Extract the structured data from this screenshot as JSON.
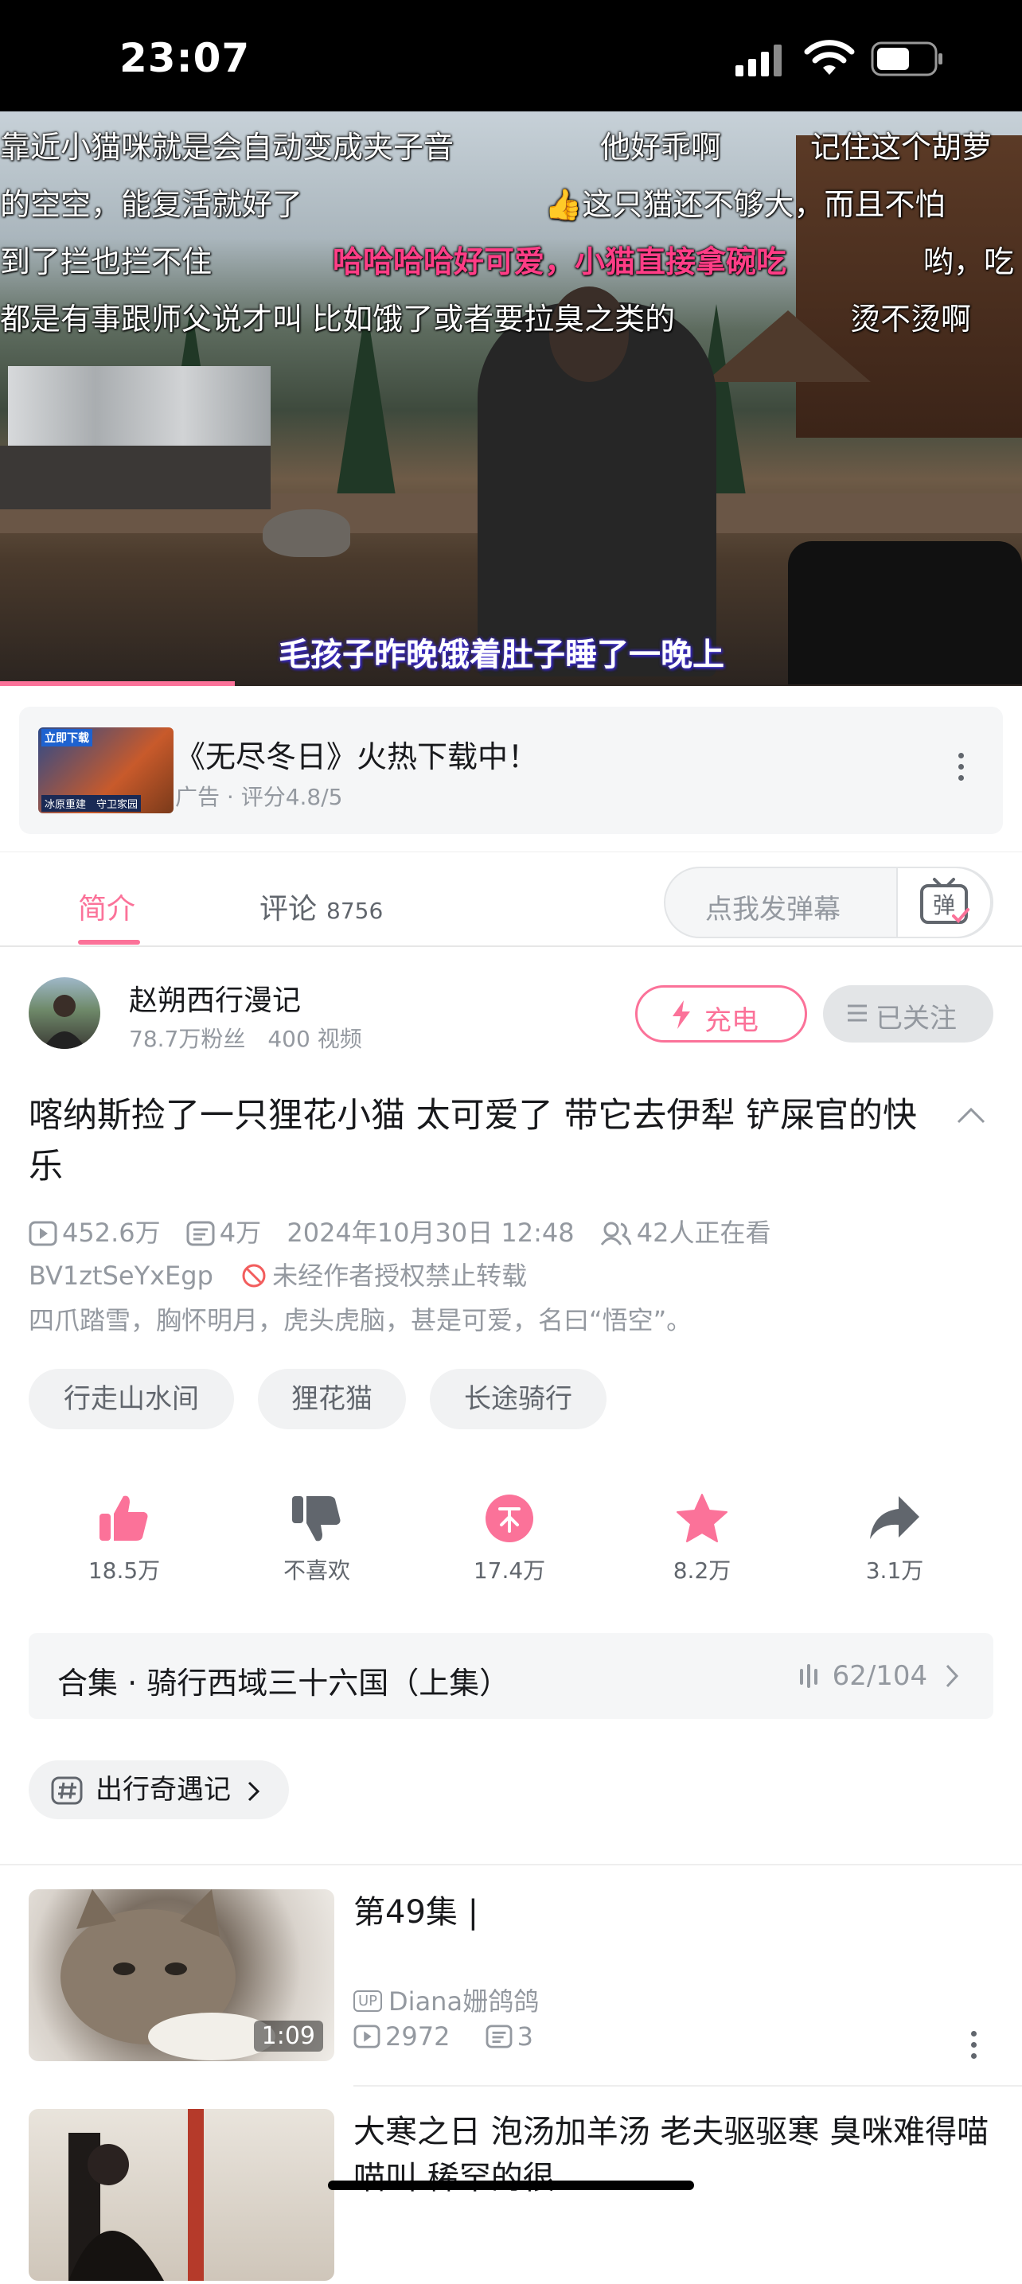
{
  "status": {
    "time": "23:07"
  },
  "video": {
    "danmaku": [
      "靠近小猫咪就是会自动变成夹子音",
      "他好乖啊",
      "记住这个胡萝",
      "的空空，能复活就好了",
      "这只猫还不够大，而且不怕",
      "到了拦也拦不住",
      "哈哈哈哈好可爱，小猫直接拿碗吃",
      "哟，吃",
      "都是有事跟师父说才叫 比如饿了或者要拉臭之类的",
      "烫不烫啊"
    ],
    "subtitle": "毛孩子昨晚饿着肚子睡了一晚上",
    "progress": 0.23
  },
  "ad": {
    "thumb_top": "立即下载",
    "thumb_bottom": "冰原重建　守卫家园",
    "title": "《无尽冬日》火热下载中！",
    "subtitle": "广告 · 评分4.8/5"
  },
  "tabs": {
    "intro": "简介",
    "comments": "评论",
    "comments_count": "8756",
    "danmu_placeholder": "点我发弹幕",
    "danmu_button": "弹"
  },
  "uploader": {
    "name": "赵朔西行漫记",
    "meta": "78.7万粉丝　400 视频",
    "charge": "充电",
    "follow": "已关注"
  },
  "video_info": {
    "title": "喀纳斯捡了一只狸花小猫 太可爱了 带它去伊犁 铲屎官的快乐",
    "plays": "452.6万",
    "danmaku_count": "4万",
    "date": "2024年10月30日 12:48",
    "watching": "42人正在看",
    "bvid": "BV1ztSeYxEgp",
    "copyright": "未经作者授权禁止转载",
    "description": "四爪踏雪，胸怀明月，虎头虎脑，甚是可爱，名曰“悟空”。",
    "tags": [
      "行走山水间",
      "狸花猫",
      "长途骑行"
    ]
  },
  "actions": {
    "like": "18.5万",
    "dislike": "不喜欢",
    "coin": "17.4万",
    "favorite": "8.2万",
    "share": "3.1万"
  },
  "collection": {
    "title": "合集 · 骑行西域三十六国（上集）",
    "progress": "62/104"
  },
  "hashtag": "出行奇遇记",
  "recommendations": [
    {
      "title": "第49集 |",
      "up": "Diana姗鸽鸽",
      "plays": "2972",
      "danmaku": "3",
      "duration": "1:09"
    },
    {
      "title": "大寒之日 泡汤加羊汤 老夫驱驱寒 臭咪难得喵喵叫 稀罕的很",
      "up": "",
      "plays": "",
      "danmaku": "",
      "duration": ""
    }
  ],
  "colors": {
    "accent": "#fb7299",
    "text": "#18191c",
    "secondary": "#9499a0"
  }
}
